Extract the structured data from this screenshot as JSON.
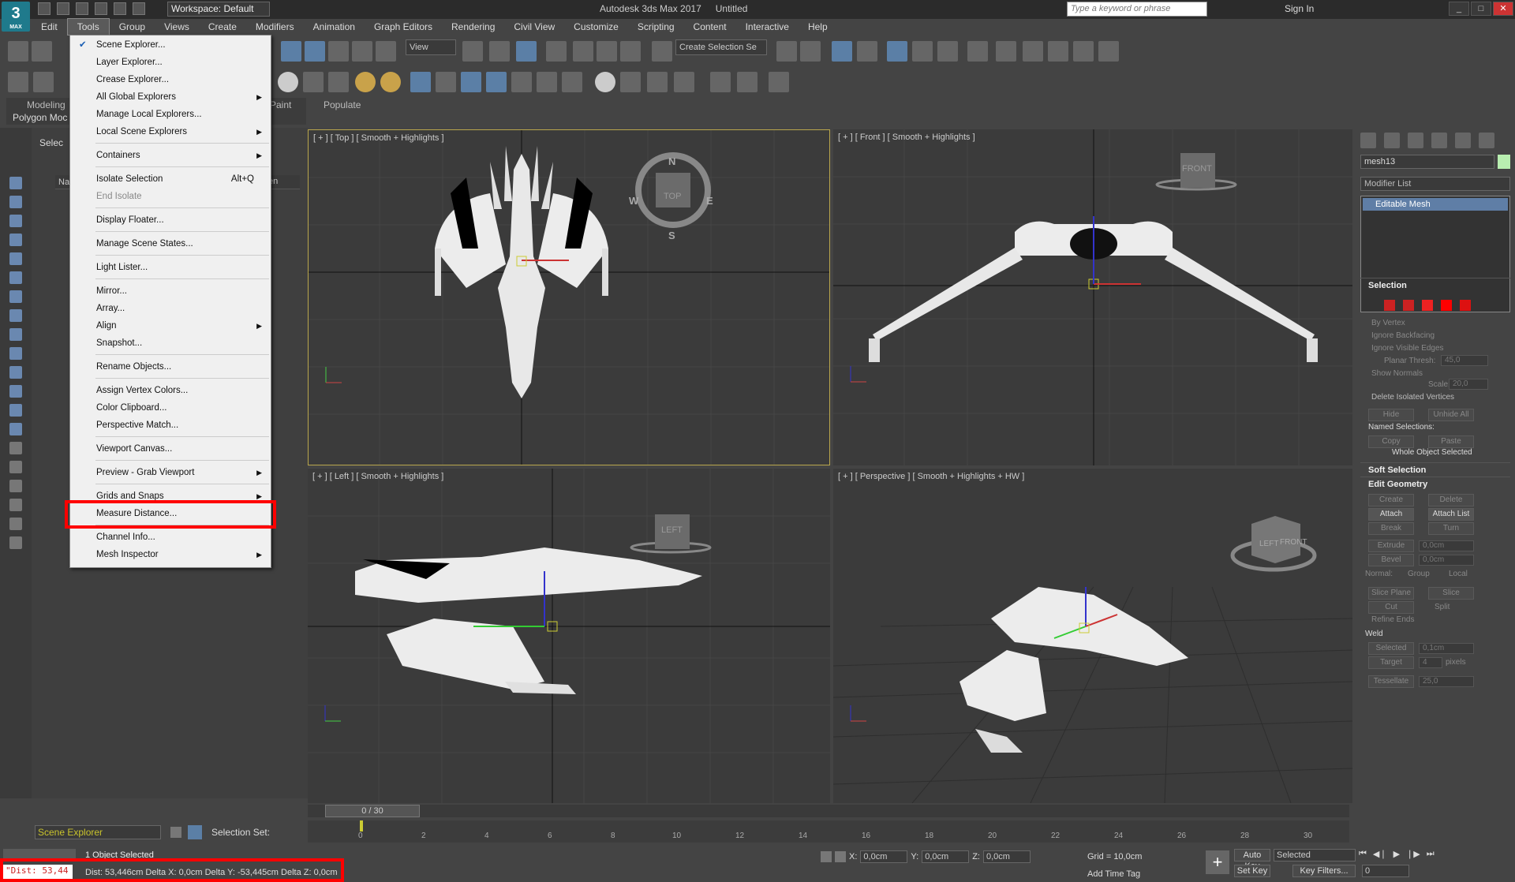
{
  "app": {
    "title": "Autodesk 3ds Max 2017",
    "document": "Untitled",
    "workspace": "Workspace: Default",
    "search_placeholder": "Type a keyword or phrase",
    "sign_in": "Sign In",
    "logo_text": "3",
    "logo_sub": "MAX"
  },
  "menubar": [
    "Edit",
    "Tools",
    "Group",
    "Views",
    "Create",
    "Modifiers",
    "Animation",
    "Graph Editors",
    "Rendering",
    "Civil View",
    "Customize",
    "Scripting",
    "Content",
    "Interactive",
    "Help"
  ],
  "toolbar": {
    "view_dropdown": "View",
    "selection_set": "Create Selection Se"
  },
  "ribbon": {
    "tab1": "Modeling",
    "tab2": "Polygon Moc",
    "paint": "Paint",
    "populate": "Populate"
  },
  "explorer": {
    "header": "Selec",
    "col_name": "Nam",
    "col_frozen": "en"
  },
  "tools_menu": {
    "items": [
      {
        "label": "Scene Explorer...",
        "checked": true
      },
      {
        "label": "Layer Explorer..."
      },
      {
        "label": "Crease Explorer..."
      },
      {
        "label": "All Global Explorers",
        "submenu": true
      },
      {
        "label": "Manage Local Explorers..."
      },
      {
        "label": "Local Scene Explorers",
        "submenu": true
      },
      {
        "label": "Containers",
        "submenu": true
      },
      {
        "label": "Isolate Selection",
        "shortcut": "Alt+Q"
      },
      {
        "label": "End Isolate",
        "disabled": true
      },
      {
        "label": "Display Floater..."
      },
      {
        "label": "Manage Scene States..."
      },
      {
        "label": "Light Lister..."
      },
      {
        "label": "Mirror..."
      },
      {
        "label": "Array..."
      },
      {
        "label": "Align",
        "submenu": true
      },
      {
        "label": "Snapshot..."
      },
      {
        "label": "Rename Objects..."
      },
      {
        "label": "Assign Vertex Colors..."
      },
      {
        "label": "Color Clipboard..."
      },
      {
        "label": "Perspective Match..."
      },
      {
        "label": "Viewport Canvas..."
      },
      {
        "label": "Preview - Grab Viewport",
        "submenu": true
      },
      {
        "label": "Grids and Snaps",
        "submenu": true
      },
      {
        "label": "Measure Distance...",
        "highlighted": true
      },
      {
        "label": "Channel Info..."
      },
      {
        "label": "Mesh Inspector",
        "submenu": true
      }
    ]
  },
  "viewports": {
    "top": {
      "label": "[ + ] [ Top ] [ Smooth + Highlights ]",
      "cube": "TOP",
      "compass": [
        "N",
        "E",
        "S",
        "W"
      ]
    },
    "front": {
      "label": "[ + ] [ Front ] [ Smooth + Highlights ]",
      "cube": "FRONT"
    },
    "left": {
      "label": "[ + ] [ Left ] [ Smooth + Highlights ]",
      "cube": "LEFT"
    },
    "perspective": {
      "label": "[ + ] [ Perspective ] [ Smooth + Highlights + HW ]",
      "cube_left": "LEFT",
      "cube_front": "FRONT"
    }
  },
  "command_panel": {
    "object_name": "mesh13",
    "modifier_list": "Modifier List",
    "stack_item": "Editable Mesh",
    "selection_rollout": "Selection",
    "by_vertex": "By Vertex",
    "ignore_backfacing": "Ignore Backfacing",
    "ignore_visible_edges": "Ignore Visible Edges",
    "planar_thresh": "Planar Thresh:",
    "planar_thresh_value": "45,0",
    "show_normals": "Show Normals",
    "scale": "Scale:",
    "scale_value": "20,0",
    "delete_isolated": "Delete Isolated Vertices",
    "hide": "Hide",
    "unhide_all": "Unhide All",
    "named_selections": "Named Selections:",
    "copy": "Copy",
    "paste": "Paste",
    "whole_object": "Whole Object Selected",
    "soft_selection": "Soft Selection",
    "edit_geometry": "Edit Geometry",
    "create": "Create",
    "delete": "Delete",
    "attach": "Attach",
    "attach_list": "Attach List",
    "break": "Break",
    "turn": "Turn",
    "extrude": "Extrude",
    "extrude_value": "0,0cm",
    "bevel": "Bevel",
    "bevel_value": "0,0cm",
    "normal": "Normal:",
    "group": "Group",
    "local": "Local",
    "slice_plane": "Slice Plane",
    "slice": "Slice",
    "cut": "Cut",
    "split": "Split",
    "refine_ends": "Refine Ends",
    "weld": "Weld",
    "selected": "Selected",
    "selected_value": "0,1cm",
    "target": "Target",
    "target_value": "4",
    "pixels": "pixels",
    "tessellate": "Tessellate",
    "tessellate_value": "25,0"
  },
  "timeline": {
    "slider": "0 / 30",
    "ticks": [
      "0",
      "2",
      "4",
      "6",
      "8",
      "10",
      "12",
      "14",
      "16",
      "18",
      "20",
      "22",
      "24",
      "26",
      "28",
      "30"
    ]
  },
  "status": {
    "scene_explorer": "Scene Explorer",
    "selection_set": "Selection Set:",
    "objects_selected": "1 Object Selected",
    "maxscript_value": "\"Dist: 53,44",
    "distance_text": "Dist: 53,446cm Delta X: 0,0cm Delta Y: -53,445cm Delta Z: 0,0cm",
    "x_label": "X:",
    "x_value": "0,0cm",
    "y_label": "Y:",
    "y_value": "0,0cm",
    "z_label": "Z:",
    "z_value": "0,0cm",
    "grid": "Grid = 10,0cm",
    "add_time_tag": "Add Time Tag",
    "auto_key": "Auto Key",
    "set_key": "Set Key",
    "key_mode": "Selected",
    "key_filters": "Key Filters...",
    "frame": "0"
  },
  "colors": {
    "highlight_box": "#ff0000",
    "active_viewport_border": "#b9a64c",
    "stack_selected": "#5f7ea6",
    "object_color": "#b8eeb0"
  }
}
